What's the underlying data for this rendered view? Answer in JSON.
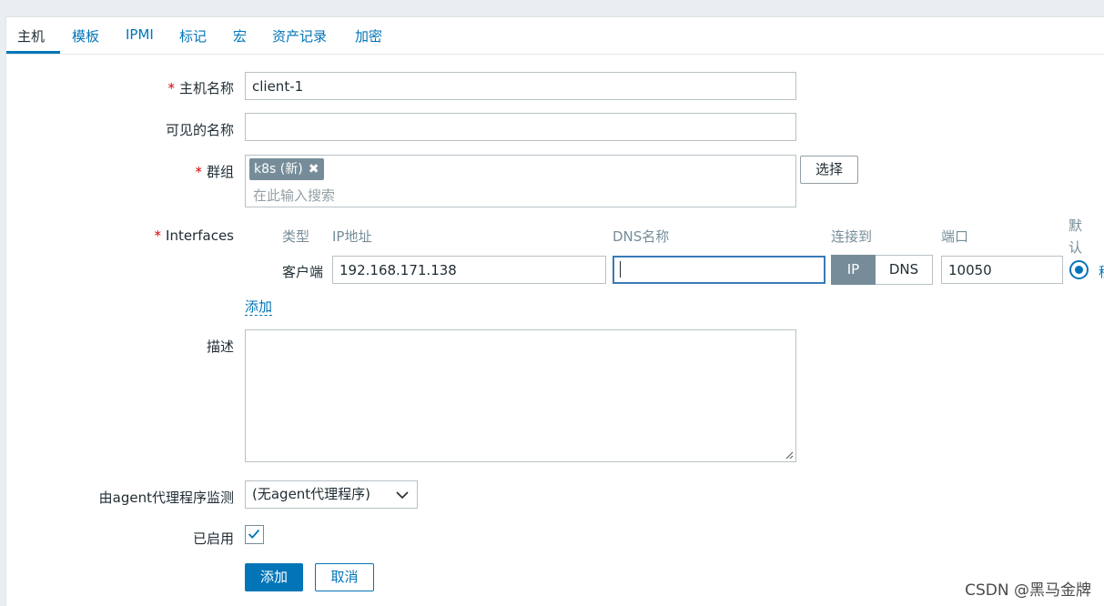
{
  "tabs": [
    {
      "label": "主机",
      "active": true
    },
    {
      "label": "模板"
    },
    {
      "label": "IPMI"
    },
    {
      "label": "标记"
    },
    {
      "label": "宏"
    },
    {
      "label": "资产记录"
    },
    {
      "label": "加密"
    }
  ],
  "form": {
    "required_mark": "*",
    "host_name": {
      "label": "主机名称",
      "value": "client-1"
    },
    "visible_name": {
      "label": "可见的名称",
      "value": ""
    },
    "groups": {
      "label": "群组",
      "chip": "k8s (新)",
      "placeholder": "在此输入搜索",
      "select_button": "选择"
    },
    "interfaces": {
      "label": "Interfaces",
      "columns": {
        "type": "类型",
        "ip": "IP地址",
        "dns": "DNS名称",
        "connect_to": "连接到",
        "port": "端口",
        "default_line1": "默",
        "default_line2": "认"
      },
      "row": {
        "type": "客户端",
        "ip": "192.168.171.138",
        "dns": "",
        "connect_ip": "IP",
        "connect_dns": "DNS",
        "connect_selected": "IP",
        "port": "10050",
        "default_selected": true,
        "cutoff_text": "移"
      },
      "add_link": "添加"
    },
    "description": {
      "label": "描述",
      "value": ""
    },
    "proxy": {
      "label": "由agent代理程序监测",
      "value": "(无agent代理程序)"
    },
    "enabled": {
      "label": "已启用",
      "checked": true
    },
    "buttons": {
      "add": "添加",
      "cancel": "取消"
    }
  },
  "watermark": "CSDN @黑马金牌",
  "colors": {
    "accent": "#0275b8",
    "required": "#d40000",
    "chip_bg": "#768d99"
  }
}
